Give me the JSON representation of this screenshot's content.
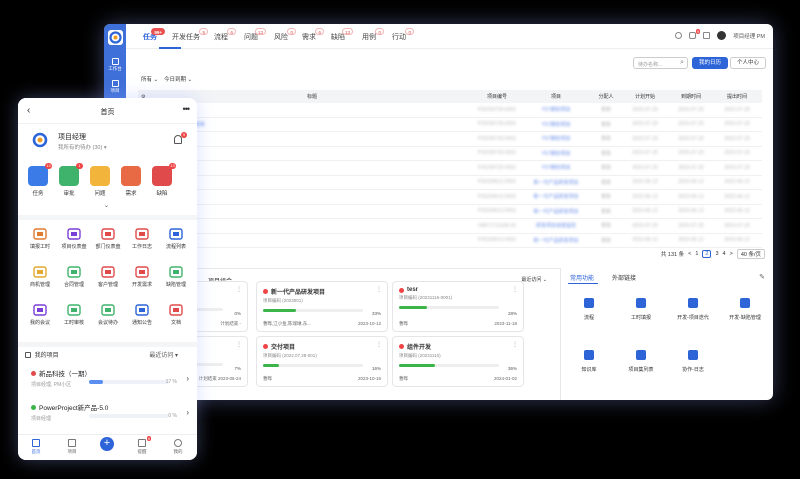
{
  "desktop": {
    "rail": {
      "items": [
        {
          "label": "工作台"
        },
        {
          "label": "项目"
        }
      ]
    },
    "tabs": [
      {
        "label": "任务",
        "badge": "99+"
      },
      {
        "label": "开发任务",
        "badge": "5"
      },
      {
        "label": "流程",
        "badge": "6"
      },
      {
        "label": "问题",
        "badge": "13"
      },
      {
        "label": "风险",
        "badge": "0"
      },
      {
        "label": "需求",
        "badge": "6"
      },
      {
        "label": "缺陷",
        "badge": "13"
      },
      {
        "label": "用例",
        "badge": "0"
      },
      {
        "label": "行动",
        "badge": "0"
      }
    ],
    "user_name": "项目经理 PM",
    "notif_badge": "9",
    "filters": {
      "all": "所有 ⌄",
      "due": "今日到期 ⌄"
    },
    "search": {
      "placeholder": "待办名称..."
    },
    "btn_my_calendar": "我的日历",
    "btn_personal": "个人中心",
    "table": {
      "headers": [
        "标题",
        "项目编号",
        "项目",
        "分配人",
        "计划开始",
        "到期时间",
        "提出时间"
      ],
      "rows": [
        [
          "项目需求评审记录",
          "P20230720-0001",
          "Y57期初项目",
          "曹联",
          "2023-07-20",
          "2023-07-20",
          "2023-07-20"
        ],
        [
          "项目开发进度报告更新",
          "P20230720-0001",
          "Y57期初项目",
          "曹联",
          "2023-07-20",
          "2023-07-20",
          "2023-07-20"
        ],
        [
          "任务",
          "P20230720-0001",
          "Y57期初项目",
          "曹联",
          "2023-07-20",
          "2023-07-20",
          "2023-07-20"
        ],
        [
          "开发任务说明",
          "P20230720-0001",
          "Y57期初项目",
          "曹联",
          "2023-07-20",
          "2023-07-20",
          "2023-07-20"
        ],
        [
          "功能设计文档审核",
          "P20230720-0001",
          "Y57期初项目",
          "曹联",
          "2023-07-20",
          "2023-07-20",
          "2023-07-20"
        ],
        [
          "测试用例 ...",
          "P20230612-0001",
          "新一代产品研发项目",
          "曹联",
          "2023-06-12",
          "2023-06-12",
          "2023-06-12"
        ],
        [
          "项目阶段评审",
          "P20230612-0001",
          "新一代产品研发项目",
          "曹联",
          "2023-06-12",
          "2023-06-12",
          "2023-06-12"
        ],
        [
          "质量检查",
          "P20230612-0001",
          "新一代产品研发项目",
          "曹联",
          "2023-06-12",
          "2023-06-12",
          "2023-06-12"
        ],
        [
          "流程审批",
          "O8071711036-01",
          "研发项目进度监控",
          "曹联",
          "2023-07-20",
          "2023-07-20",
          "2023-07-20"
        ],
        [
          "需求确认",
          "P20230612-0001",
          "新一代产品研发项目",
          "曹联",
          "2023-06-12",
          "2023-06-12",
          "2023-06-12"
        ]
      ]
    },
    "pager": {
      "total": "共 131 条",
      "prev": "<",
      "p1": "1",
      "p2": "2",
      "p3": "3",
      "p4": "4",
      "next": ">",
      "size": "40 条/页"
    },
    "portfolio_title": "项目组合",
    "portfolio_sort": "最近访问 ⌄",
    "projects": [
      {
        "name": "设计划",
        "code": "(0001)",
        "pct": "0%",
        "owner": "",
        "date_label": "计划结束",
        "date": "-",
        "dot": "r",
        "fill": 0
      },
      {
        "name": "新一代产品研发项目",
        "code": "项目编码 (2023001)",
        "pct": "33%",
        "owner": "曹晔,江小鱼,陈瑞琳,东...",
        "date_label": "",
        "date": "2023-10-12",
        "dot": "r",
        "fill": 0.33
      },
      {
        "name": "tesr",
        "code": "项目编码 (20231116-0001)",
        "pct": "28%",
        "owner": "曹晔",
        "date_label": "",
        "date": "2023-11-18",
        "dot": "r",
        "fill": 0.28
      },
      {
        "name": "划",
        "code": "(0001)",
        "pct": "7%",
        "owner": "",
        "date_label": "计划结束",
        "date": "2023-06-24",
        "dot": "r",
        "fill": 0.07
      },
      {
        "name": "交付项目",
        "code": "项目编码 (2022.07.28-001)",
        "pct": "16%",
        "owner": "曹晔",
        "date_label": "",
        "date": "2023-10-16",
        "dot": "r",
        "fill": 0.16
      },
      {
        "name": "组件开发",
        "code": "项目编码 (20231110)",
        "pct": "36%",
        "owner": "曹晔",
        "date_label": "",
        "date": "2024-01-02",
        "dot": "r",
        "fill": 0.36
      }
    ],
    "quick_tabs": {
      "common": "常用功能",
      "external": "外部链接"
    },
    "quick_items": [
      {
        "label": "流程",
        "icon": "flow-icon"
      },
      {
        "label": "工时填报",
        "icon": "timesheet-icon"
      },
      {
        "label": "开发-项目迭代",
        "icon": "layers-icon"
      },
      {
        "label": "开发-缺陷管理",
        "icon": "bug-icon"
      },
      {
        "label": "知识库",
        "icon": "book-icon"
      },
      {
        "label": "项目集列表",
        "icon": "grid-icon"
      },
      {
        "label": "协作-日志",
        "icon": "log-icon"
      }
    ]
  },
  "mobile": {
    "title": "首页",
    "user": "项目经理",
    "todo": "我所有的待办 (30) ▾",
    "bell_badge": "9",
    "apps": [
      {
        "label": "任务",
        "badge": "13",
        "color": "#3b7be8"
      },
      {
        "label": "审批",
        "badge": "1",
        "color": "#3fb36b"
      },
      {
        "label": "问题",
        "badge": "",
        "color": "#f2b43a"
      },
      {
        "label": "需求",
        "badge": "",
        "color": "#e86a45"
      },
      {
        "label": "缺陷",
        "badge": "13",
        "color": "#e04a4a"
      }
    ],
    "tools": [
      {
        "label": "填报工时",
        "icon": "clock-icon"
      },
      {
        "label": "项目仪表盘",
        "icon": "bar-chart-icon"
      },
      {
        "label": "部门仪表盘",
        "icon": "dept-chart-icon"
      },
      {
        "label": "工作日志",
        "icon": "journal-icon"
      },
      {
        "label": "流程列表",
        "icon": "flowchart-icon"
      },
      {
        "label": "商机管理",
        "icon": "opportunity-icon"
      },
      {
        "label": "合同管理",
        "icon": "contract-icon"
      },
      {
        "label": "客户管理",
        "icon": "customer-icon"
      },
      {
        "label": "开发需求",
        "icon": "dev-req-icon"
      },
      {
        "label": "缺陷管理",
        "icon": "bug-manage-icon"
      },
      {
        "label": "我的会议",
        "icon": "meeting-icon"
      },
      {
        "label": "工时审核",
        "icon": "review-icon"
      },
      {
        "label": "会议待办",
        "icon": "meeting-todo-icon"
      },
      {
        "label": "通知公告",
        "icon": "notice-icon"
      },
      {
        "label": "文档",
        "icon": "doc-icon"
      }
    ],
    "my_projects": "我的项目",
    "recent": "最近访问 ▾",
    "projects": [
      {
        "name": "新品科技（一期）",
        "sub": "项目经理, PM小区",
        "pct": "17 %",
        "fill": 0.17,
        "dot": "#e04a4a"
      },
      {
        "name": "PowerProject新产品-5.0",
        "sub": "项目经理",
        "pct": "0 %",
        "fill": 0,
        "dot": "#3bb54a"
      }
    ],
    "nav": [
      {
        "label": "首页"
      },
      {
        "label": "项目"
      },
      {
        "label": ""
      },
      {
        "label": "提醒",
        "badge": "9"
      },
      {
        "label": "我的"
      }
    ]
  }
}
